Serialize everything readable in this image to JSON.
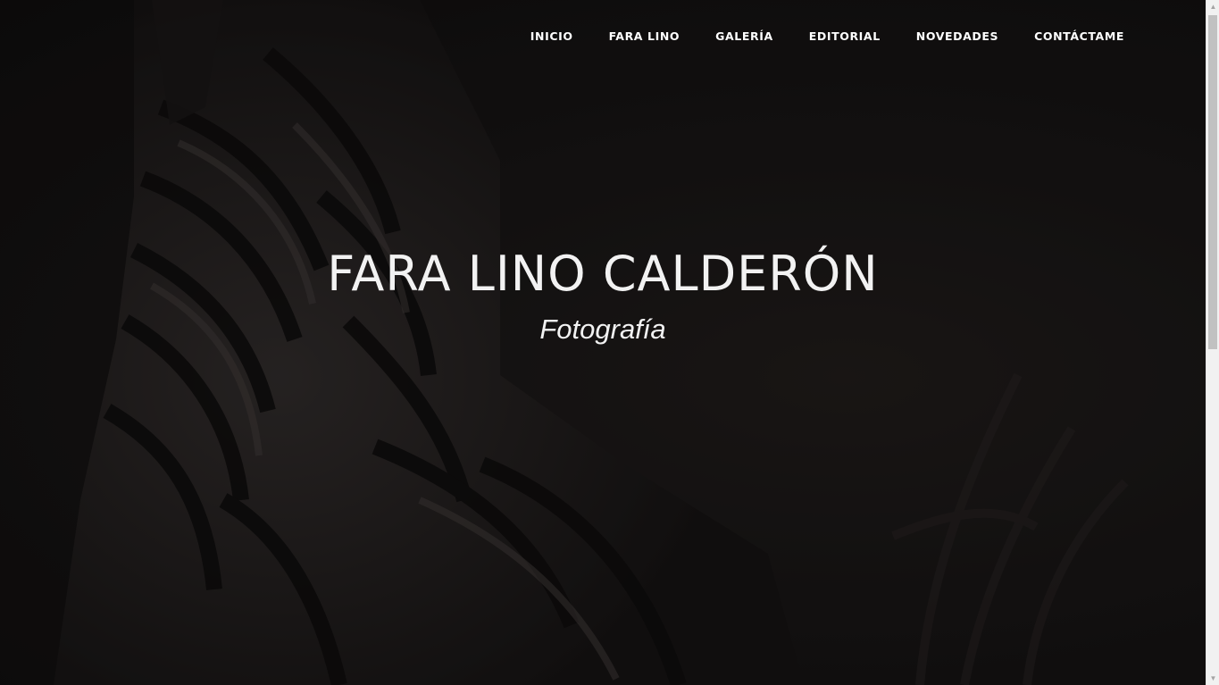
{
  "nav": {
    "items": [
      {
        "label": "INICIO"
      },
      {
        "label": "FARA LINO"
      },
      {
        "label": "GALERÍA"
      },
      {
        "label": "EDITORIAL"
      },
      {
        "label": "NOVEDADES"
      },
      {
        "label": "CONTÁCTAME"
      }
    ]
  },
  "hero": {
    "title": "FARA LINO CALDERÓN",
    "subtitle": "Fotografía",
    "background_image": "zebra-photo",
    "text_color": "#f2f2f2"
  },
  "scrollbar": {
    "up_icon": "scroll-up-arrow-icon",
    "down_icon": "scroll-down-arrow-icon"
  }
}
